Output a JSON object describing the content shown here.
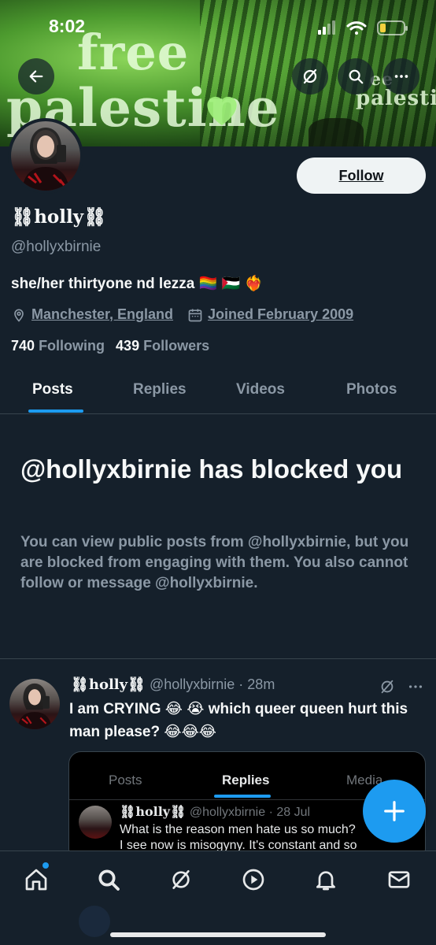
{
  "status_bar": {
    "time": "8:02"
  },
  "banner": {
    "text_line1": "free",
    "text_line2": "palestine",
    "text_small1": "ee",
    "text_small2": "palestine"
  },
  "profile": {
    "display_name": "⛓holly⛓",
    "handle": "@hollyxbirnie",
    "bio": "she/her thirtyone nd lezza 🏳️‍🌈 🇵🇸 ❤️‍🔥",
    "location": "Manchester, England",
    "joined": "Joined February 2009",
    "following_count": "740",
    "following_label": "Following",
    "followers_count": "439",
    "followers_label": "Followers",
    "follow_button": "Follow"
  },
  "tabs": [
    {
      "label": "Posts",
      "active": true
    },
    {
      "label": "Replies",
      "active": false
    },
    {
      "label": "Videos",
      "active": false
    },
    {
      "label": "Photos",
      "active": false
    }
  ],
  "blocked": {
    "title": "@hollyxbirnie has blocked you",
    "description": "You can view public posts from @hollyxbirnie, but you are blocked from engaging with them. You also cannot follow or message @hollyxbirnie."
  },
  "post": {
    "name": "⛓holly⛓",
    "handle": "@hollyxbirnie",
    "time": "· 28m",
    "text": "I am CRYING 😂 😭 which queer queen hurt this man please? 😂😂😂",
    "embed": {
      "tabs": [
        {
          "label": "Posts",
          "active": false
        },
        {
          "label": "Replies",
          "active": true
        },
        {
          "label": "Media",
          "active": false
        }
      ],
      "name": "⛓holly⛓",
      "handle": "@hollyxbirnie",
      "time": "· 28 Jul",
      "line1": "What is the reason men hate us so much?",
      "line2": "I see now is misogyny. It's constant and so"
    }
  },
  "icons": {
    "back": "back-arrow-icon",
    "grok": "grok-icon",
    "search": "search-icon",
    "more": "more-icon",
    "location": "location-pin-icon",
    "calendar": "calendar-icon",
    "compose": "plus-icon",
    "nav": [
      "home-icon",
      "search-icon",
      "grok-icon",
      "video-icon",
      "notifications-icon",
      "messages-icon"
    ]
  },
  "colors": {
    "accent": "#1d9bf0",
    "background": "#15202b",
    "muted": "#8b98a5"
  }
}
